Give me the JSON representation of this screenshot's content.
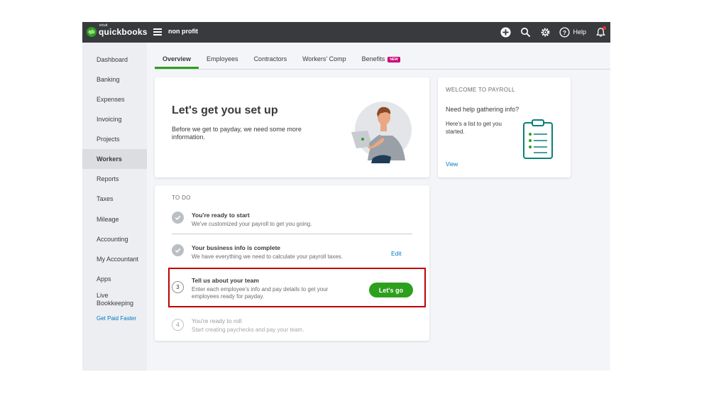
{
  "topbar": {
    "logo_badge": "qb",
    "logo_intuit": "intuit",
    "logo_text": "quickbooks",
    "company_name": "non profit",
    "help_label": "Help",
    "icons": [
      "plus-icon",
      "search-icon",
      "gear-icon",
      "help-icon",
      "bell-icon"
    ]
  },
  "sidebar": {
    "items": [
      {
        "label": "Dashboard"
      },
      {
        "label": "Banking"
      },
      {
        "label": "Expenses"
      },
      {
        "label": "Invoicing"
      },
      {
        "label": "Projects"
      },
      {
        "label": "Workers",
        "active": true
      },
      {
        "label": "Reports"
      },
      {
        "label": "Taxes"
      },
      {
        "label": "Mileage"
      },
      {
        "label": "Accounting"
      },
      {
        "label": "My Accountant"
      },
      {
        "label": "Apps"
      },
      {
        "label": "Live Bookkeeping"
      },
      {
        "label": "Get Paid Faster"
      }
    ]
  },
  "tabs": [
    {
      "label": "Overview",
      "active": true
    },
    {
      "label": "Employees"
    },
    {
      "label": "Contractors"
    },
    {
      "label": "Workers' Comp"
    },
    {
      "label": "Benefits",
      "badge": "NEW"
    }
  ],
  "setup": {
    "title": "Let's get you set up",
    "subtitle": "Before we get to payday, we need some more information."
  },
  "welcome": {
    "heading": "WELCOME TO PAYROLL",
    "question": "Need help gathering info?",
    "text": "Here's a list to get you started.",
    "link": "View"
  },
  "todo": {
    "heading": "TO DO",
    "steps": [
      {
        "number": "",
        "status": "done",
        "title": "You're ready to start",
        "desc": "We've customized your payroll to get you going."
      },
      {
        "number": "",
        "status": "done",
        "title": "Your business info is complete",
        "desc": "We have everything we need to calculate your payroll taxes.",
        "action": "Edit"
      },
      {
        "number": "3",
        "status": "current",
        "title": "Tell us about your team",
        "desc": "Enter each employee's info and pay details to get your employees ready for payday.",
        "action": "Let's go"
      },
      {
        "number": "4",
        "status": "pending",
        "title": "You're ready to roll",
        "desc": "Start creating paychecks and pay your team."
      }
    ]
  },
  "colors": {
    "brand_green": "#2ca01c",
    "topbar": "#393a3d",
    "link_blue": "#0077c5",
    "highlight_red": "#c00000",
    "badge_pink": "#c9007a"
  }
}
